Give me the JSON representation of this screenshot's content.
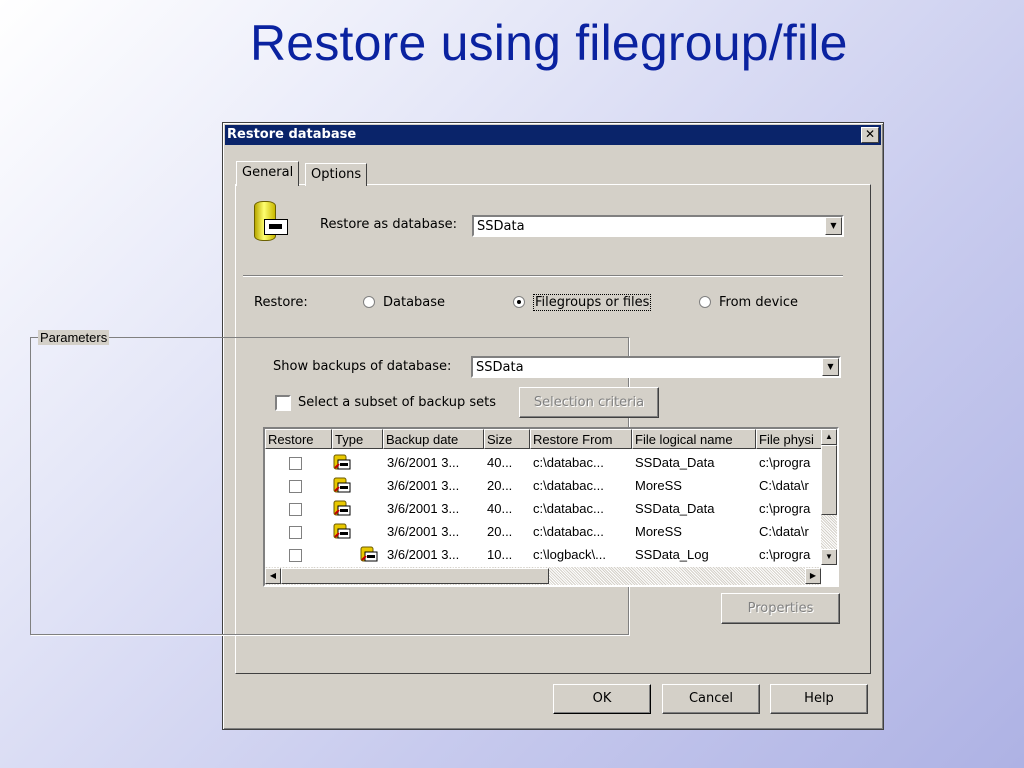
{
  "slide": {
    "title": "Restore using filegroup/file"
  },
  "dialog": {
    "title": "Restore database",
    "close_glyph": "✕",
    "tabs": [
      {
        "label": "General",
        "selected": true
      },
      {
        "label": "Options",
        "selected": false
      }
    ],
    "restore_as_label": "Restore as database:",
    "restore_as_value": "SSData",
    "restore_label": "Restore:",
    "restore_options": [
      {
        "label": "Database",
        "checked": false
      },
      {
        "label": "Filegroups or files",
        "checked": true
      },
      {
        "label": "From device",
        "checked": false
      }
    ],
    "parameters": {
      "group_label": "Parameters",
      "show_backups_label": "Show backups of database:",
      "show_backups_value": "SSData",
      "subset_label": "Select a subset of backup sets",
      "subset_checked": false,
      "selection_criteria_label": "Selection criteria",
      "properties_label": "Properties"
    },
    "table": {
      "columns": [
        "Restore",
        "Type",
        "Backup date",
        "Size",
        "Restore From",
        "File logical name",
        "File physi"
      ],
      "rows": [
        {
          "restore": false,
          "type_icon": "filegroup-backup-icon",
          "backup_date": "3/6/2001 3...",
          "size": "40...",
          "restore_from": "c:\\databac...",
          "file_logical": "SSData_Data",
          "file_physical": "c:\\progra"
        },
        {
          "restore": false,
          "type_icon": "filegroup-backup-icon",
          "backup_date": "3/6/2001 3...",
          "size": "20...",
          "restore_from": "c:\\databac...",
          "file_logical": "MoreSS",
          "file_physical": "C:\\data\\r"
        },
        {
          "restore": false,
          "type_icon": "filegroup-backup-icon",
          "backup_date": "3/6/2001 3...",
          "size": "40...",
          "restore_from": "c:\\databac...",
          "file_logical": "SSData_Data",
          "file_physical": "c:\\progra"
        },
        {
          "restore": false,
          "type_icon": "filegroup-backup-icon",
          "backup_date": "3/6/2001 3...",
          "size": "20...",
          "restore_from": "c:\\databac...",
          "file_logical": "MoreSS",
          "file_physical": "C:\\data\\r"
        },
        {
          "restore": false,
          "type_icon": "log-backup-icon",
          "backup_date": "3/6/2001 3...",
          "size": "10...",
          "restore_from": "c:\\logback\\...",
          "file_logical": "SSData_Log",
          "file_physical": "c:\\progra"
        }
      ]
    },
    "buttons": {
      "ok": "OK",
      "cancel": "Cancel",
      "help": "Help"
    }
  }
}
